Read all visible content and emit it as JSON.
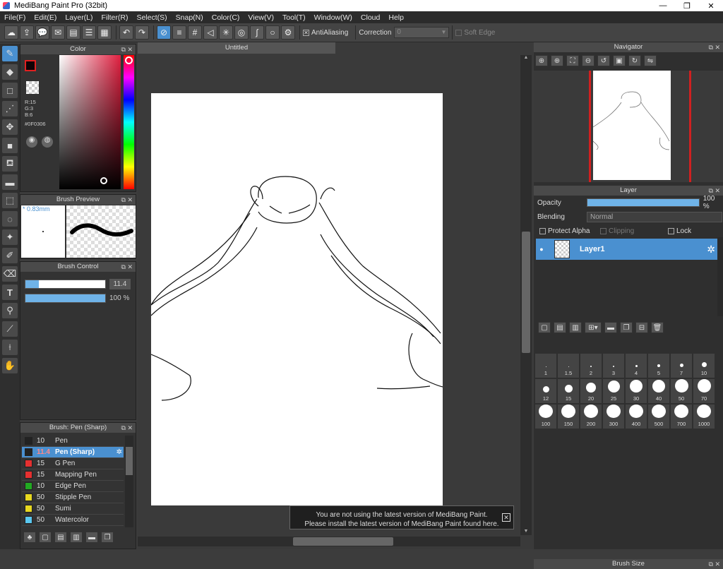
{
  "titlebar": {
    "title": "MediBang Paint Pro (32bit)",
    "min": "—",
    "restore": "❐",
    "close": "✕"
  },
  "menu": [
    "File(F)",
    "Edit(E)",
    "Layer(L)",
    "Filter(R)",
    "Select(S)",
    "Snap(N)",
    "Color(C)",
    "View(V)",
    "Tool(T)",
    "Window(W)",
    "Cloud",
    "Help"
  ],
  "toolbar": {
    "antialiasing": "AntiAliasing",
    "correction_label": "Correction",
    "correction_value": "0",
    "soft_edge": "Soft Edge"
  },
  "color": {
    "title": "Color",
    "fg": "#0F0306",
    "r": "R:15",
    "g": "G:3",
    "b": "B:6",
    "hex": "#0F0306"
  },
  "brush_preview": {
    "title": "Brush Preview",
    "size": "* 0.83mm"
  },
  "brush_control": {
    "title": "Brush Control",
    "size_value": "11.4",
    "opacity_value": "100 %",
    "size_fraction": 0.17,
    "opacity_fraction": 1.0
  },
  "brush_list": {
    "title": "Brush: Pen (Sharp)",
    "items": [
      {
        "size": "10",
        "name": "Pen",
        "color": "#222222"
      },
      {
        "size": "11.4",
        "name": "Pen (Sharp)",
        "color": "#222222",
        "selected": true
      },
      {
        "size": "15",
        "name": "G Pen",
        "color": "#e53030"
      },
      {
        "size": "15",
        "name": "Mapping Pen",
        "color": "#e53030"
      },
      {
        "size": "10",
        "name": "Edge Pen",
        "color": "#22aa22"
      },
      {
        "size": "50",
        "name": "Stipple Pen",
        "color": "#e8d820"
      },
      {
        "size": "50",
        "name": "Sumi",
        "color": "#e8d820"
      },
      {
        "size": "50",
        "name": "Watercolor",
        "color": "#5ac8f0"
      }
    ]
  },
  "document": {
    "tab": "Untitled"
  },
  "navigator": {
    "title": "Navigator"
  },
  "layer": {
    "title": "Layer",
    "opacity_label": "Opacity",
    "opacity_value": "100 %",
    "blending_label": "Blending",
    "blending_value": "Normal",
    "protect_alpha": "Protect Alpha",
    "clipping": "Clipping",
    "lock": "Lock",
    "layer_name": "Layer1"
  },
  "brush_size": {
    "title": "Brush Size",
    "sizes": [
      "1",
      "1.5",
      "2",
      "3",
      "4",
      "5",
      "7",
      "10",
      "12",
      "15",
      "20",
      "25",
      "30",
      "40",
      "50",
      "70",
      "100",
      "150",
      "200",
      "300",
      "400",
      "500",
      "700",
      "1000"
    ]
  },
  "notice": {
    "line1": "You are not using the latest version of MediBang Paint.",
    "line2": "Please install the latest version of MediBang Paint found here."
  }
}
